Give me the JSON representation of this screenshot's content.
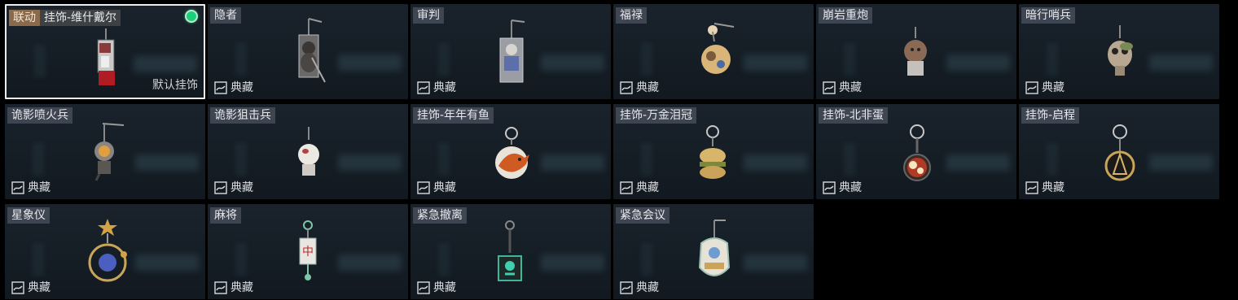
{
  "items": [
    {
      "tag": "联动",
      "name": "挂饰-维什戴尔",
      "default_label": "默认挂饰",
      "icon": "pendant-vishdail-icon"
    },
    {
      "name": "隐者",
      "rarity": "典藏",
      "icon": "pendant-hermit-icon"
    },
    {
      "name": "审判",
      "rarity": "典藏",
      "icon": "pendant-judgement-icon"
    },
    {
      "name": "福禄",
      "rarity": "典藏",
      "icon": "pendant-gourd-icon"
    },
    {
      "name": "崩岩重炮",
      "rarity": "典藏",
      "icon": "pendant-rockcannon-icon"
    },
    {
      "name": "暗行哨兵",
      "rarity": "典藏",
      "icon": "pendant-skull-icon"
    },
    {
      "name": "诡影喷火兵",
      "rarity": "典藏",
      "icon": "pendant-flamer-icon"
    },
    {
      "name": "诡影狙击兵",
      "rarity": "典藏",
      "icon": "pendant-sniper-icon"
    },
    {
      "name": "挂饰-年年有鱼",
      "rarity": "典藏",
      "icon": "pendant-fish-icon"
    },
    {
      "name": "挂饰-万金泪冠",
      "rarity": "典藏",
      "icon": "pendant-burger-icon"
    },
    {
      "name": "挂饰-北非蛋",
      "rarity": "典藏",
      "icon": "pendant-shakshuka-icon"
    },
    {
      "name": "挂饰-启程",
      "rarity": "典藏",
      "icon": "pendant-compass-icon"
    },
    {
      "name": "星象仪",
      "rarity": "典藏",
      "icon": "pendant-orrery-icon"
    },
    {
      "name": "麻将",
      "rarity": "典藏",
      "icon": "pendant-mahjong-icon"
    },
    {
      "name": "紧急撤离",
      "rarity": "典藏",
      "icon": "pendant-exit-sign-icon"
    },
    {
      "name": "紧急会议",
      "rarity": "典藏",
      "icon": "pendant-meeting-icon"
    }
  ],
  "colors": {
    "selected_border": "#e9edf0",
    "equipped_dot": "#1bd07a",
    "collab_tag": "#8a6a4a"
  }
}
